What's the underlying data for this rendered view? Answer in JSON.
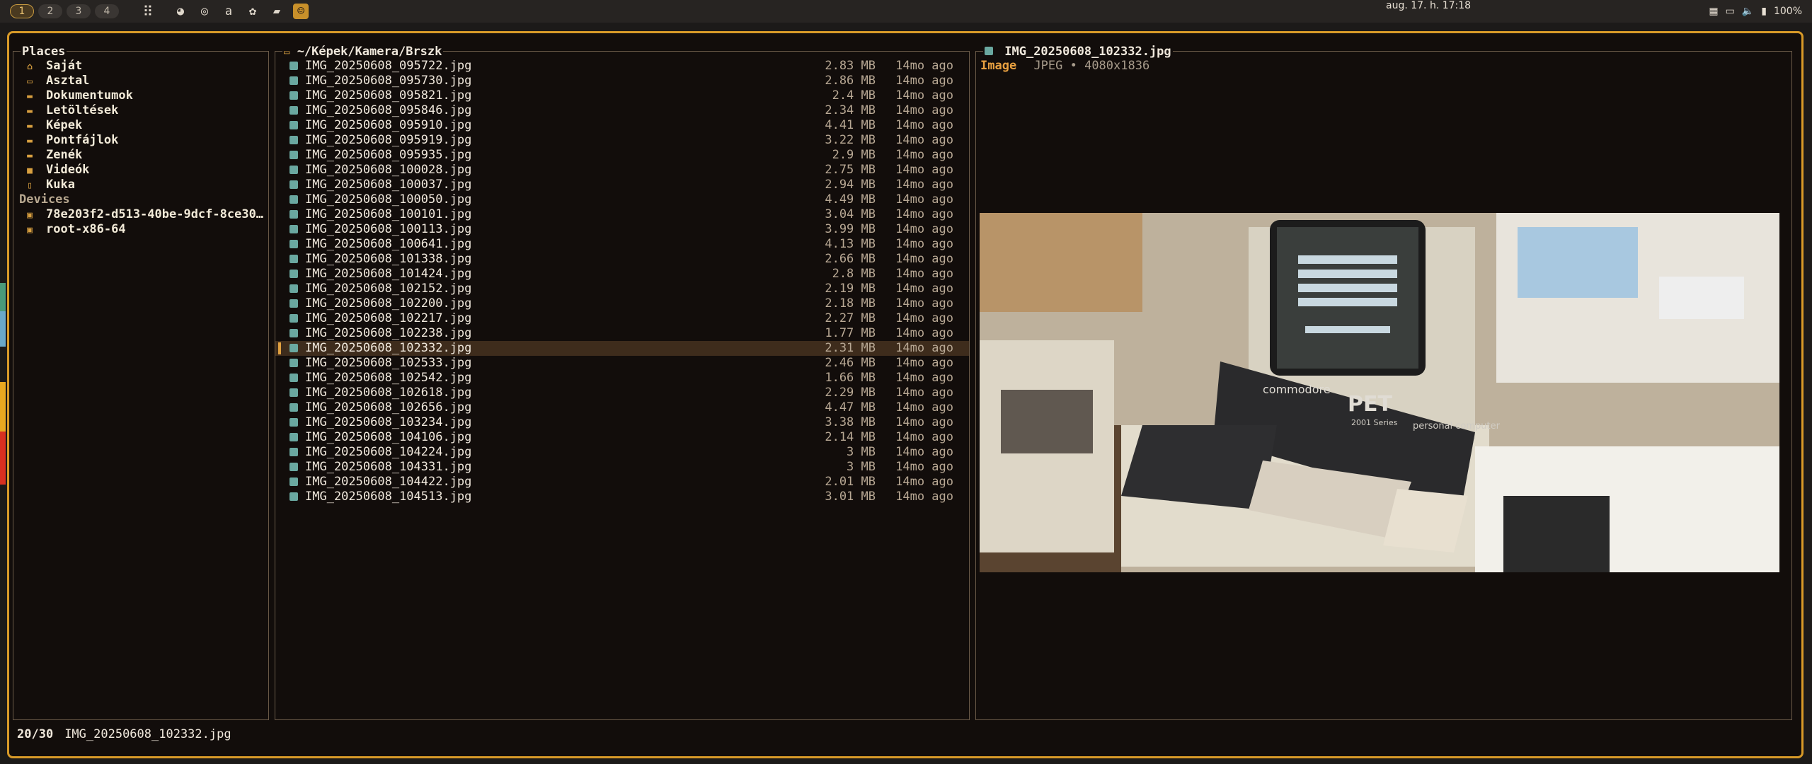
{
  "topbar": {
    "workspaces": [
      "1",
      "2",
      "3",
      "4"
    ],
    "active_workspace": "1",
    "apps": [
      "grid-icon",
      "firefox-icon",
      "chrome-icon",
      "amazon-icon",
      "gnome-icon",
      "files-icon",
      "cat-icon"
    ],
    "clock": "aug. 17. h. 17:18",
    "battery": "100%"
  },
  "places": {
    "title": "Places",
    "items": [
      {
        "label": "Saját",
        "icon": "home-icon"
      },
      {
        "label": "Asztal",
        "icon": "desktop-icon"
      },
      {
        "label": "Dokumentumok",
        "icon": "folder-icon"
      },
      {
        "label": "Letöltések",
        "icon": "folder-icon"
      },
      {
        "label": "Képek",
        "icon": "folder-icon"
      },
      {
        "label": "Pontfájlok",
        "icon": "folder-icon"
      },
      {
        "label": "Zenék",
        "icon": "folder-icon"
      },
      {
        "label": "Videók",
        "icon": "video-icon"
      },
      {
        "label": "Kuka",
        "icon": "trash-icon"
      }
    ],
    "devices_title": "Devices",
    "devices": [
      {
        "label": "78e203f2-d513-40be-9dcf-8ce30…",
        "icon": "drive-icon"
      },
      {
        "label": "root-x86-64",
        "icon": "drive-icon"
      }
    ]
  },
  "files": {
    "path": "~/Képek/Kamera/Brszk",
    "selected_index": 19,
    "rows": [
      {
        "name": "IMG_20250608_095722.jpg",
        "size": "2.83 MB",
        "age": "14mo ago"
      },
      {
        "name": "IMG_20250608_095730.jpg",
        "size": "2.86 MB",
        "age": "14mo ago"
      },
      {
        "name": "IMG_20250608_095821.jpg",
        "size": "2.4 MB",
        "age": "14mo ago"
      },
      {
        "name": "IMG_20250608_095846.jpg",
        "size": "2.34 MB",
        "age": "14mo ago"
      },
      {
        "name": "IMG_20250608_095910.jpg",
        "size": "4.41 MB",
        "age": "14mo ago"
      },
      {
        "name": "IMG_20250608_095919.jpg",
        "size": "3.22 MB",
        "age": "14mo ago"
      },
      {
        "name": "IMG_20250608_095935.jpg",
        "size": "2.9 MB",
        "age": "14mo ago"
      },
      {
        "name": "IMG_20250608_100028.jpg",
        "size": "2.75 MB",
        "age": "14mo ago"
      },
      {
        "name": "IMG_20250608_100037.jpg",
        "size": "2.94 MB",
        "age": "14mo ago"
      },
      {
        "name": "IMG_20250608_100050.jpg",
        "size": "4.49 MB",
        "age": "14mo ago"
      },
      {
        "name": "IMG_20250608_100101.jpg",
        "size": "3.04 MB",
        "age": "14mo ago"
      },
      {
        "name": "IMG_20250608_100113.jpg",
        "size": "3.99 MB",
        "age": "14mo ago"
      },
      {
        "name": "IMG_20250608_100641.jpg",
        "size": "4.13 MB",
        "age": "14mo ago"
      },
      {
        "name": "IMG_20250608_101338.jpg",
        "size": "2.66 MB",
        "age": "14mo ago"
      },
      {
        "name": "IMG_20250608_101424.jpg",
        "size": "2.8 MB",
        "age": "14mo ago"
      },
      {
        "name": "IMG_20250608_102152.jpg",
        "size": "2.19 MB",
        "age": "14mo ago"
      },
      {
        "name": "IMG_20250608_102200.jpg",
        "size": "2.18 MB",
        "age": "14mo ago"
      },
      {
        "name": "IMG_20250608_102217.jpg",
        "size": "2.27 MB",
        "age": "14mo ago"
      },
      {
        "name": "IMG_20250608_102238.jpg",
        "size": "1.77 MB",
        "age": "14mo ago"
      },
      {
        "name": "IMG_20250608_102332.jpg",
        "size": "2.31 MB",
        "age": "14mo ago"
      },
      {
        "name": "IMG_20250608_102533.jpg",
        "size": "2.46 MB",
        "age": "14mo ago"
      },
      {
        "name": "IMG_20250608_102542.jpg",
        "size": "1.66 MB",
        "age": "14mo ago"
      },
      {
        "name": "IMG_20250608_102618.jpg",
        "size": "2.29 MB",
        "age": "14mo ago"
      },
      {
        "name": "IMG_20250608_102656.jpg",
        "size": "4.47 MB",
        "age": "14mo ago"
      },
      {
        "name": "IMG_20250608_103234.jpg",
        "size": "3.38 MB",
        "age": "14mo ago"
      },
      {
        "name": "IMG_20250608_104106.jpg",
        "size": "2.14 MB",
        "age": "14mo ago"
      },
      {
        "name": "IMG_20250608_104224.jpg",
        "size": "3 MB",
        "age": "14mo ago"
      },
      {
        "name": "IMG_20250608_104331.jpg",
        "size": "3 MB",
        "age": "14mo ago"
      },
      {
        "name": "IMG_20250608_104422.jpg",
        "size": "2.01 MB",
        "age": "14mo ago"
      },
      {
        "name": "IMG_20250608_104513.jpg",
        "size": "3.01 MB",
        "age": "14mo ago"
      }
    ]
  },
  "preview": {
    "title": "IMG_20250608_102332.jpg",
    "kind": "Image",
    "info": "JPEG • 4080x1836",
    "photo_text": {
      "brand": "commodore",
      "model": "PET",
      "series": "2001 Series",
      "tagline": "personal computer"
    }
  },
  "status": {
    "position": "20/30",
    "filename": "IMG_20250608_102332.jpg"
  },
  "colors": {
    "accent": "#d89a28",
    "selection": "#3e2c1c",
    "folder": "#d8a040",
    "file_icon": "#6aa8a0"
  }
}
